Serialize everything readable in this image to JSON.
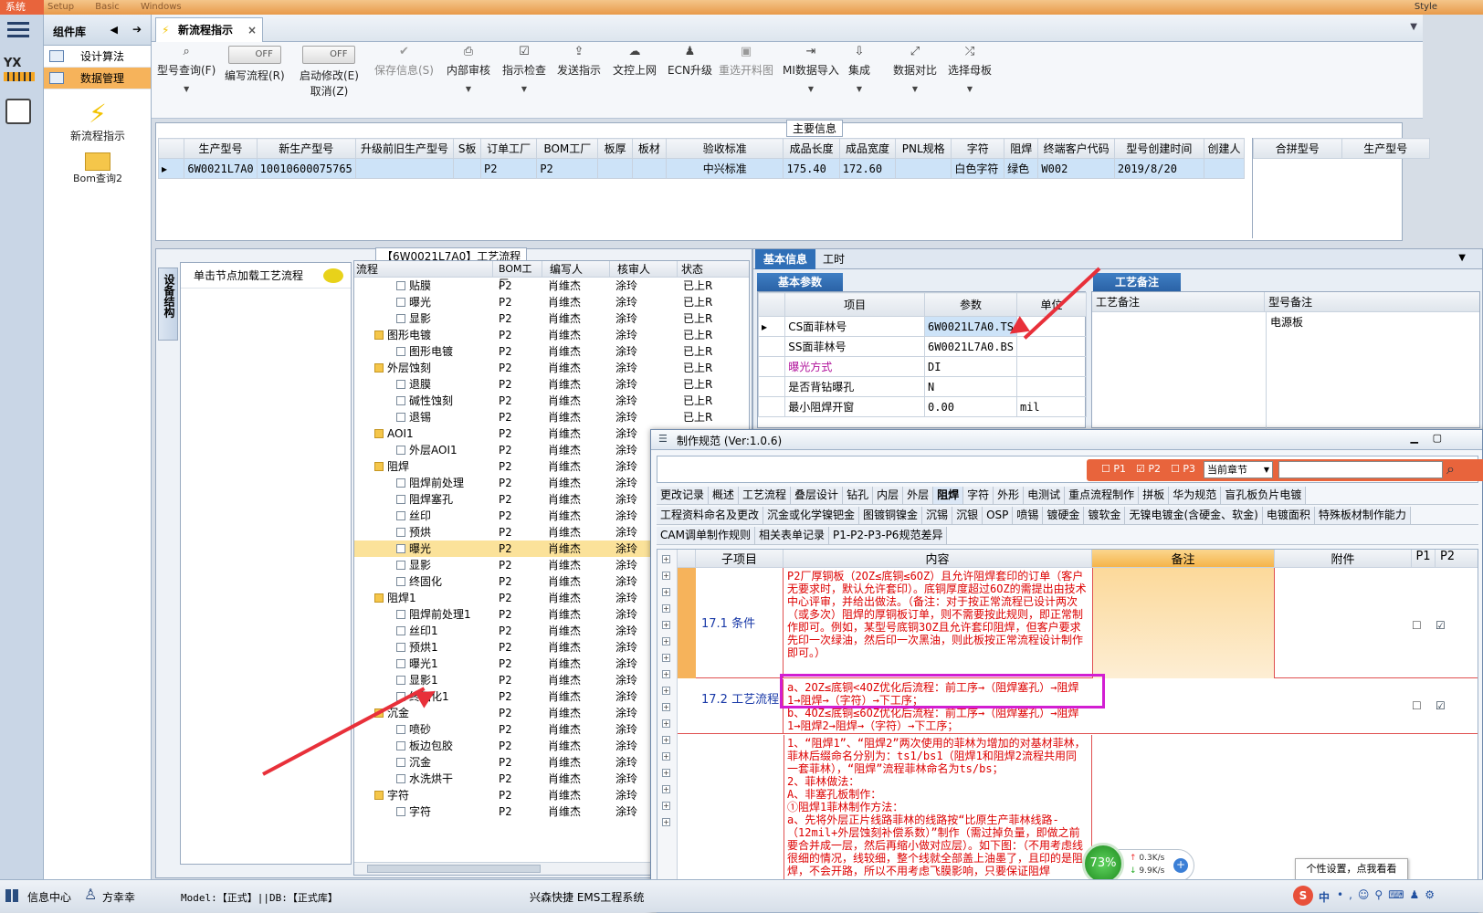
{
  "titlebar": {
    "system_label": "系统",
    "menus": [
      "Setup",
      "Basic",
      "Windows"
    ],
    "right_text": "Style"
  },
  "component_panel": {
    "title": "组件库",
    "nav_items": [
      {
        "label": "设计算法"
      },
      {
        "label": "数据管理"
      }
    ],
    "tools": [
      {
        "label": "新流程指示"
      },
      {
        "label": "Bom查询2"
      }
    ]
  },
  "tab": {
    "label": "新流程指示"
  },
  "toolbar": {
    "items": [
      {
        "label": "型号查询(F)",
        "icon": "search-icon"
      },
      {
        "label": "编写流程(R)",
        "icon": "toggle-off",
        "toggle": "OFF"
      },
      {
        "label": "启动修改(E)",
        "sub": "取消(Z)",
        "toggle": "OFF"
      },
      {
        "label": "保存信息(S)",
        "icon": "check-icon",
        "disabled": true
      },
      {
        "label": "内部审核",
        "icon": "print-icon"
      },
      {
        "label": "指示检查",
        "icon": "check-box-icon"
      },
      {
        "label": "发送指示",
        "icon": "upload-icon"
      },
      {
        "label": "文控上网",
        "icon": "cloud-upload-icon"
      },
      {
        "label": "ECN升级",
        "icon": "people-icon"
      },
      {
        "label": "重选开料图",
        "icon": "image-icon",
        "disabled": true
      },
      {
        "label": "MI数据导入",
        "icon": "import-icon"
      },
      {
        "label": "集成",
        "icon": "download-icon"
      },
      {
        "label": "数据对比",
        "icon": "compare-icon"
      },
      {
        "label": "选择母板",
        "icon": "shuffle-icon"
      }
    ]
  },
  "main_info": {
    "section_title": "主要信息",
    "columns": [
      "生产型号",
      "新生产型号",
      "升级前旧生产型号",
      "S板",
      "订单工厂",
      "BOM工厂",
      "板厚",
      "板材",
      "验收标准",
      "成品长度",
      "成品宽度",
      "PNL规格",
      "字符",
      "阻焊",
      "终端客户代码",
      "型号创建时间",
      "创建人"
    ],
    "row": [
      "6W0021L7A0",
      "10010600075765",
      "",
      "",
      "P2",
      "P2",
      "",
      "",
      "中兴标准",
      "175.40",
      "172.60",
      "",
      "白色字符",
      "绿色",
      "W002",
      "2019/8/20",
      ""
    ],
    "side_columns": [
      "合拼型号",
      "生产型号"
    ]
  },
  "process": {
    "section_title": "【6W0021L7A0】工艺流程",
    "side_tab": "设备结构",
    "hint": "单击节点加载工艺流程",
    "columns": [
      "流程",
      "BOM工厂",
      "编写人",
      "核审人",
      "状态"
    ],
    "rows": [
      {
        "name": "贴膜",
        "level": 2,
        "bom": "P2",
        "writer": "肖维杰",
        "reviewer": "涂玲",
        "status": "已上R"
      },
      {
        "name": "曝光",
        "level": 2,
        "bom": "P2",
        "writer": "肖维杰",
        "reviewer": "涂玲",
        "status": "已上R"
      },
      {
        "name": "显影",
        "level": 2,
        "bom": "P2",
        "writer": "肖维杰",
        "reviewer": "涂玲",
        "status": "已上R"
      },
      {
        "name": "图形电镀",
        "level": 1,
        "bom": "P2",
        "writer": "肖维杰",
        "reviewer": "涂玲",
        "status": "已上R"
      },
      {
        "name": "图形电镀",
        "level": 2,
        "bom": "P2",
        "writer": "肖维杰",
        "reviewer": "涂玲",
        "status": "已上R"
      },
      {
        "name": "外层蚀刻",
        "level": 1,
        "bom": "P2",
        "writer": "肖维杰",
        "reviewer": "涂玲",
        "status": "已上R"
      },
      {
        "name": "退膜",
        "level": 2,
        "bom": "P2",
        "writer": "肖维杰",
        "reviewer": "涂玲",
        "status": "已上R"
      },
      {
        "name": "碱性蚀刻",
        "level": 2,
        "bom": "P2",
        "writer": "肖维杰",
        "reviewer": "涂玲",
        "status": "已上R"
      },
      {
        "name": "退锡",
        "level": 2,
        "bom": "P2",
        "writer": "肖维杰",
        "reviewer": "涂玲",
        "status": "已上R"
      },
      {
        "name": "AOI1",
        "level": 1,
        "bom": "P2",
        "writer": "肖维杰",
        "reviewer": "涂玲",
        "status": ""
      },
      {
        "name": "外层AOI1",
        "level": 2,
        "bom": "P2",
        "writer": "肖维杰",
        "reviewer": "涂玲",
        "status": ""
      },
      {
        "name": "阻焊",
        "level": 1,
        "bom": "P2",
        "writer": "肖维杰",
        "reviewer": "涂玲",
        "status": ""
      },
      {
        "name": "阻焊前处理",
        "level": 2,
        "bom": "P2",
        "writer": "肖维杰",
        "reviewer": "涂玲",
        "status": ""
      },
      {
        "name": "阻焊塞孔",
        "level": 2,
        "bom": "P2",
        "writer": "肖维杰",
        "reviewer": "涂玲",
        "status": ""
      },
      {
        "name": "丝印",
        "level": 2,
        "bom": "P2",
        "writer": "肖维杰",
        "reviewer": "涂玲",
        "status": ""
      },
      {
        "name": "预烘",
        "level": 2,
        "bom": "P2",
        "writer": "肖维杰",
        "reviewer": "涂玲",
        "status": ""
      },
      {
        "name": "曝光",
        "level": 2,
        "bom": "P2",
        "writer": "肖维杰",
        "reviewer": "涂玲",
        "status": "",
        "selected": true
      },
      {
        "name": "显影",
        "level": 2,
        "bom": "P2",
        "writer": "肖维杰",
        "reviewer": "涂玲",
        "status": ""
      },
      {
        "name": "终固化",
        "level": 2,
        "bom": "P2",
        "writer": "肖维杰",
        "reviewer": "涂玲",
        "status": ""
      },
      {
        "name": "阻焊1",
        "level": 1,
        "bom": "P2",
        "writer": "肖维杰",
        "reviewer": "涂玲",
        "status": ""
      },
      {
        "name": "阻焊前处理1",
        "level": 2,
        "bom": "P2",
        "writer": "肖维杰",
        "reviewer": "涂玲",
        "status": ""
      },
      {
        "name": "丝印1",
        "level": 2,
        "bom": "P2",
        "writer": "肖维杰",
        "reviewer": "涂玲",
        "status": ""
      },
      {
        "name": "预烘1",
        "level": 2,
        "bom": "P2",
        "writer": "肖维杰",
        "reviewer": "涂玲",
        "status": ""
      },
      {
        "name": "曝光1",
        "level": 2,
        "bom": "P2",
        "writer": "肖维杰",
        "reviewer": "涂玲",
        "status": ""
      },
      {
        "name": "显影1",
        "level": 2,
        "bom": "P2",
        "writer": "肖维杰",
        "reviewer": "涂玲",
        "status": ""
      },
      {
        "name": "终固化1",
        "level": 2,
        "bom": "P2",
        "writer": "肖维杰",
        "reviewer": "涂玲",
        "status": ""
      },
      {
        "name": "沉金",
        "level": 1,
        "bom": "P2",
        "writer": "肖维杰",
        "reviewer": "涂玲",
        "status": ""
      },
      {
        "name": "喷砂",
        "level": 2,
        "bom": "P2",
        "writer": "肖维杰",
        "reviewer": "涂玲",
        "status": ""
      },
      {
        "name": "板边包胶",
        "level": 2,
        "bom": "P2",
        "writer": "肖维杰",
        "reviewer": "涂玲",
        "status": ""
      },
      {
        "name": "沉金",
        "level": 2,
        "bom": "P2",
        "writer": "肖维杰",
        "reviewer": "涂玲",
        "status": ""
      },
      {
        "name": "水洗烘干",
        "level": 2,
        "bom": "P2",
        "writer": "肖维杰",
        "reviewer": "涂玲",
        "status": ""
      },
      {
        "name": "字符",
        "level": 1,
        "bom": "P2",
        "writer": "肖维杰",
        "reviewer": "涂玲",
        "status": ""
      },
      {
        "name": "字符",
        "level": 2,
        "bom": "P2",
        "writer": "肖维杰",
        "reviewer": "涂玲",
        "status": ""
      }
    ]
  },
  "basic_info": {
    "tabs": [
      "基本信息",
      "工时"
    ],
    "subtab": "基本参数",
    "columns": [
      "项目",
      "参数",
      "单位"
    ],
    "rows": [
      {
        "item": "CS面菲林号",
        "value": "6W0021L7A0.TS",
        "unit": ""
      },
      {
        "item": "SS面菲林号",
        "value": "6W0021L7A0.BS",
        "unit": ""
      },
      {
        "item": "曝光方式",
        "value": "DI",
        "unit": "",
        "highlight": true
      },
      {
        "item": "是否背钻曝孔",
        "value": "N",
        "unit": ""
      },
      {
        "item": "最小阻焊开窗",
        "value": "0.00",
        "unit": "mil"
      }
    ],
    "remark_tab": "工艺备注",
    "remark_columns": [
      "工艺备注",
      "型号备注"
    ],
    "remark_value": "电源板"
  },
  "spec_window": {
    "title": "制作规范 (Ver:1.0.6)",
    "filters": [
      "P1",
      "P2",
      "P3"
    ],
    "chapter_select": "当前章节",
    "tabs_row1": [
      "更改记录",
      "概述",
      "工艺流程",
      "叠层设计",
      "钻孔",
      "内层",
      "外层",
      "阻焊",
      "字符",
      "外形",
      "电测试",
      "重点流程制作",
      "拼板",
      "华为规范",
      "盲孔板负片电镀"
    ],
    "tabs_row2": [
      "工程资料命名及更改",
      "沉金或化学镍钯金",
      "图镀铜镍金",
      "沉锡",
      "沉银",
      "OSP",
      "喷锡",
      "镀硬金",
      "镀软金",
      "无镍电镀金(含硬金、软金)",
      "电镀面积",
      "特殊板材制作能力"
    ],
    "tabs_row3": [
      "CAM调单制作规则",
      "相关表单记录",
      "P1-P2-P3-P6规范差异"
    ],
    "columns": [
      "子项目",
      "内容",
      "备注",
      "附件",
      "P1",
      "P2"
    ],
    "rows": [
      {
        "sub": "17.1 条件",
        "content": "P2厂厚铜板（2OZ≤底铜≤6OZ）且允许阻焊套印的订单（客户无要求时，默认允许套印）。底铜厚度超过6OZ的需提出由技术中心评审，并给出做法。（备注：对于按正常流程已设计两次（或多次）阻焊的厚铜板订单，则不需要按此规则，即正常制作即可。例如，某型号底铜3OZ且允许套印阻焊，但客户要求先印一次绿油，然后印一次黑油，则此板按正常流程设计制作即可。）",
        "p2": true
      },
      {
        "sub": "17.2 工艺流程",
        "content": "a、2OZ≤底铜<4OZ优化后流程：前工序→（阻焊塞孔）→阻焊1→阻焊→（字符）→下工序；\nb、4OZ≤底铜≤6OZ优化后流程：前工序→（阻焊塞孔）→阻焊1→阻焊2→阻焊→（字符）→下工序；",
        "p2": true
      },
      {
        "sub": "",
        "content": "1、“阻焊1”、“阻焊2”两次使用的菲林为增加的对基材菲林，菲林后缀命名分别为：ts1/bs1（阻焊1和阻焊2流程共用同一套菲林），“阻焊”流程菲林命名为ts/bs；\n2、菲林做法：\nA、非塞孔板制作：\n①阻焊1菲林制作方法：\na、先将外层正片线路菲林的线路按“比原生产菲林线路-（12mil+外层蚀刻补偿系数）”制作（需过掉负量，即做之前要合并成一层，然后再缩小做对应层）。如下图：（不用考虑线很细的情况，线较细，整个线就全部盖上油墨了，且印的是阻焊，不会开路，所以不用考虑飞膜影响，只要保证阻焊"
      }
    ]
  },
  "statusbar": {
    "info_center": "信息中心",
    "user": "方幸幸",
    "model_text": "Model:【正式】||DB:【正式库】",
    "system_text": "兴森快捷 EMS工程系统"
  },
  "tray": {
    "percent": "73%",
    "up_speed": "0.3K/s",
    "down_speed": "9.9K/s",
    "tooltip": "个性设置，点我看看",
    "ime_label": "中"
  }
}
